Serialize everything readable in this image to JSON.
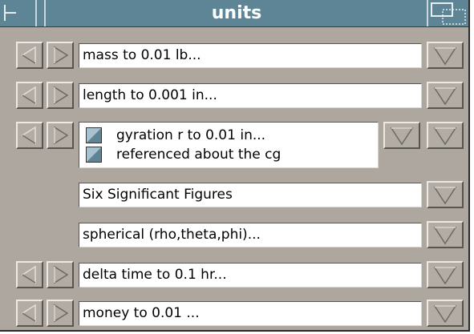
{
  "window": {
    "title": "units",
    "colors": {
      "titlebar": "#5d8596",
      "panel": "#ada7a0",
      "field": "#ffffff"
    }
  },
  "rows": [
    {
      "label": "mass to 0.01 lb...",
      "has_steppers": true
    },
    {
      "label": "length to 0.001 in...",
      "has_steppers": true
    },
    {
      "lines": [
        "gyration r to 0.01 in...",
        "referenced about the cg"
      ],
      "has_steppers": true
    },
    {
      "label": "Six Significant Figures",
      "has_steppers": false
    },
    {
      "label": "spherical (rho,theta,phi)...",
      "has_steppers": false
    },
    {
      "label": "delta time to 0.1 hr...",
      "has_steppers": true
    },
    {
      "label": "money to 0.01 ...",
      "has_steppers": true
    }
  ],
  "icons": {
    "prev": "triangle-left-icon",
    "next": "triangle-right-icon",
    "menu": "triangle-down-icon",
    "close": "close-corner-icon",
    "resize": "resize-icon"
  }
}
